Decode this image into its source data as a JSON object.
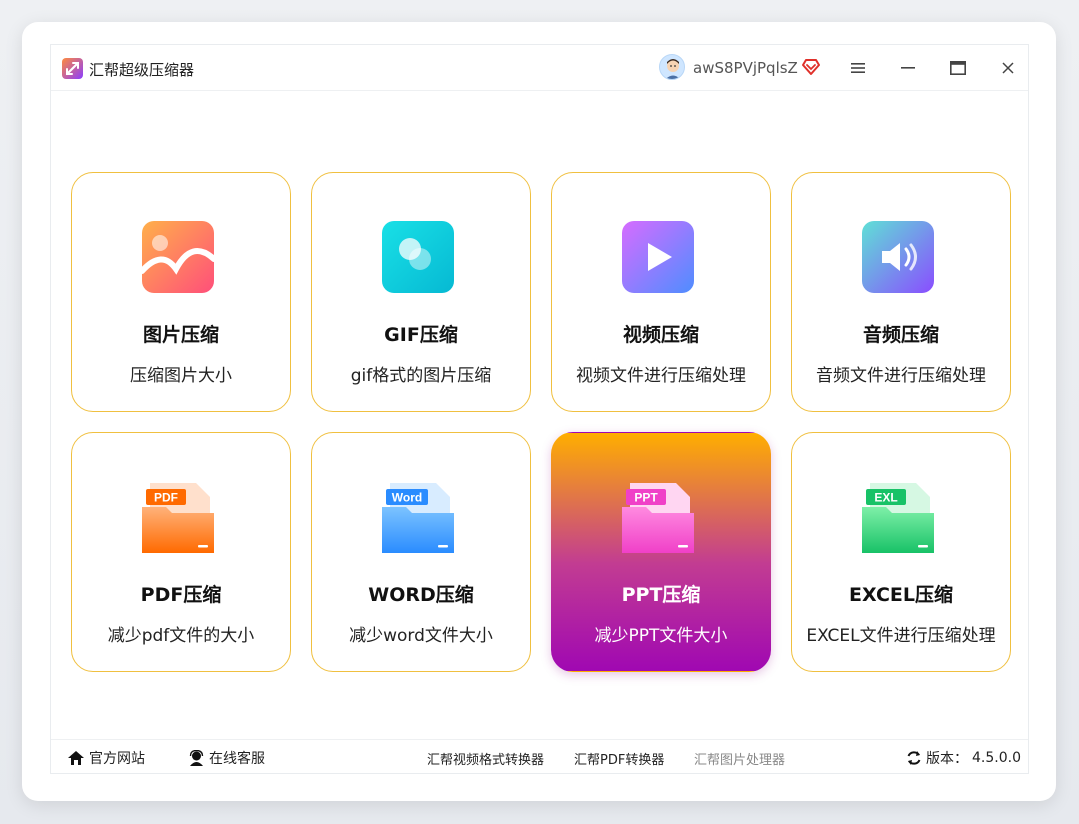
{
  "window": {
    "app_title": "汇帮超级压缩器",
    "username": "awS8PVjPqlsZ"
  },
  "cards": [
    {
      "title": "图片压缩",
      "desc": "压缩图片大小",
      "icon": "image-icon"
    },
    {
      "title": "GIF压缩",
      "desc": "gif格式的图片压缩",
      "icon": "gif-icon"
    },
    {
      "title": "视频压缩",
      "desc": "视频文件进行压缩处理",
      "icon": "video-icon"
    },
    {
      "title": "音频压缩",
      "desc": "音频文件进行压缩处理",
      "icon": "audio-icon"
    },
    {
      "title": "PDF压缩",
      "desc": "减少pdf文件的大小",
      "icon": "pdf-file-icon",
      "badge": "PDF"
    },
    {
      "title": "WORD压缩",
      "desc": "减少word文件大小",
      "icon": "word-file-icon",
      "badge": "Word"
    },
    {
      "title": "PPT压缩",
      "desc": "减少PPT文件大小",
      "icon": "ppt-file-icon",
      "badge": "PPT",
      "active": true
    },
    {
      "title": "EXCEL压缩",
      "desc": "EXCEL文件进行压缩处理",
      "icon": "excel-file-icon",
      "badge": "EXL"
    }
  ],
  "footer": {
    "website": "官方网站",
    "support": "在线客服",
    "links": [
      "汇帮视频格式转换器",
      "汇帮PDF转换器",
      "汇帮图片处理器"
    ],
    "version_label": "版本：",
    "version": "4.5.0.0"
  },
  "colors": {
    "card_border": "#f0c040",
    "active_gradient_top": "#ffae00",
    "active_gradient_bottom": "#a008b2"
  }
}
